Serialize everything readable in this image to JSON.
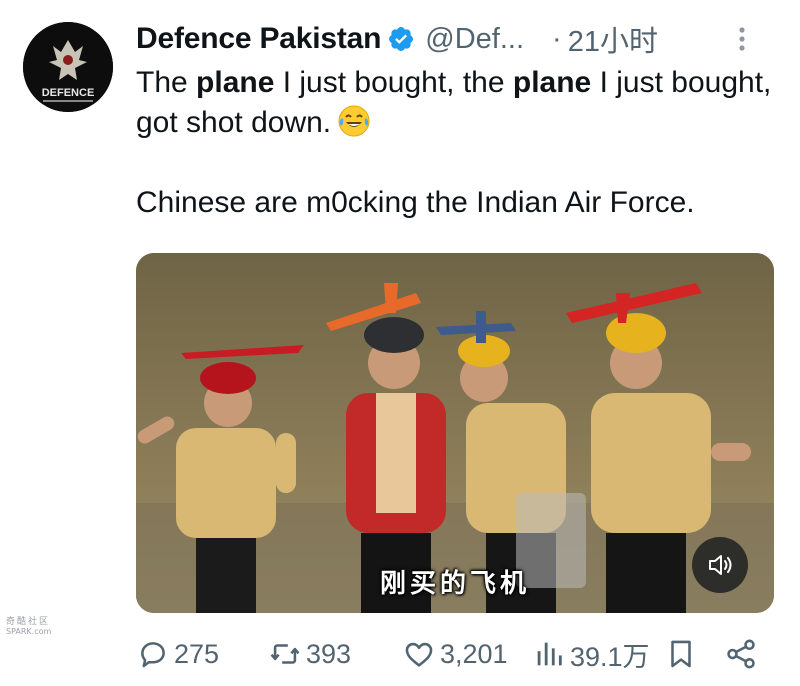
{
  "author": {
    "display_name": "Defence Pakistan",
    "handle": "@Def...",
    "separator": "·",
    "time": "21小时",
    "avatar_text": "DEFENCE"
  },
  "tweet": {
    "line1_pre": "The ",
    "bold1": "plane",
    "line1_mid": " I just bought, the ",
    "bold2": "plane",
    "line1_post": " I just bought, got shot down.",
    "emoji": "face-with-tears-of-joy",
    "paragraph2": "Chinese are m0cking the Indian Air Force."
  },
  "media": {
    "subtitle": "刚买的飞机"
  },
  "watermark": {
    "line1": "奇酷社区",
    "line2": "SPARK.com"
  },
  "actions": {
    "replies": "275",
    "retweets": "393",
    "likes": "3,201",
    "views": "39.1万"
  },
  "colors": {
    "text": "#0f1419",
    "secondary": "#536471",
    "verified": "#1d9bf0"
  }
}
